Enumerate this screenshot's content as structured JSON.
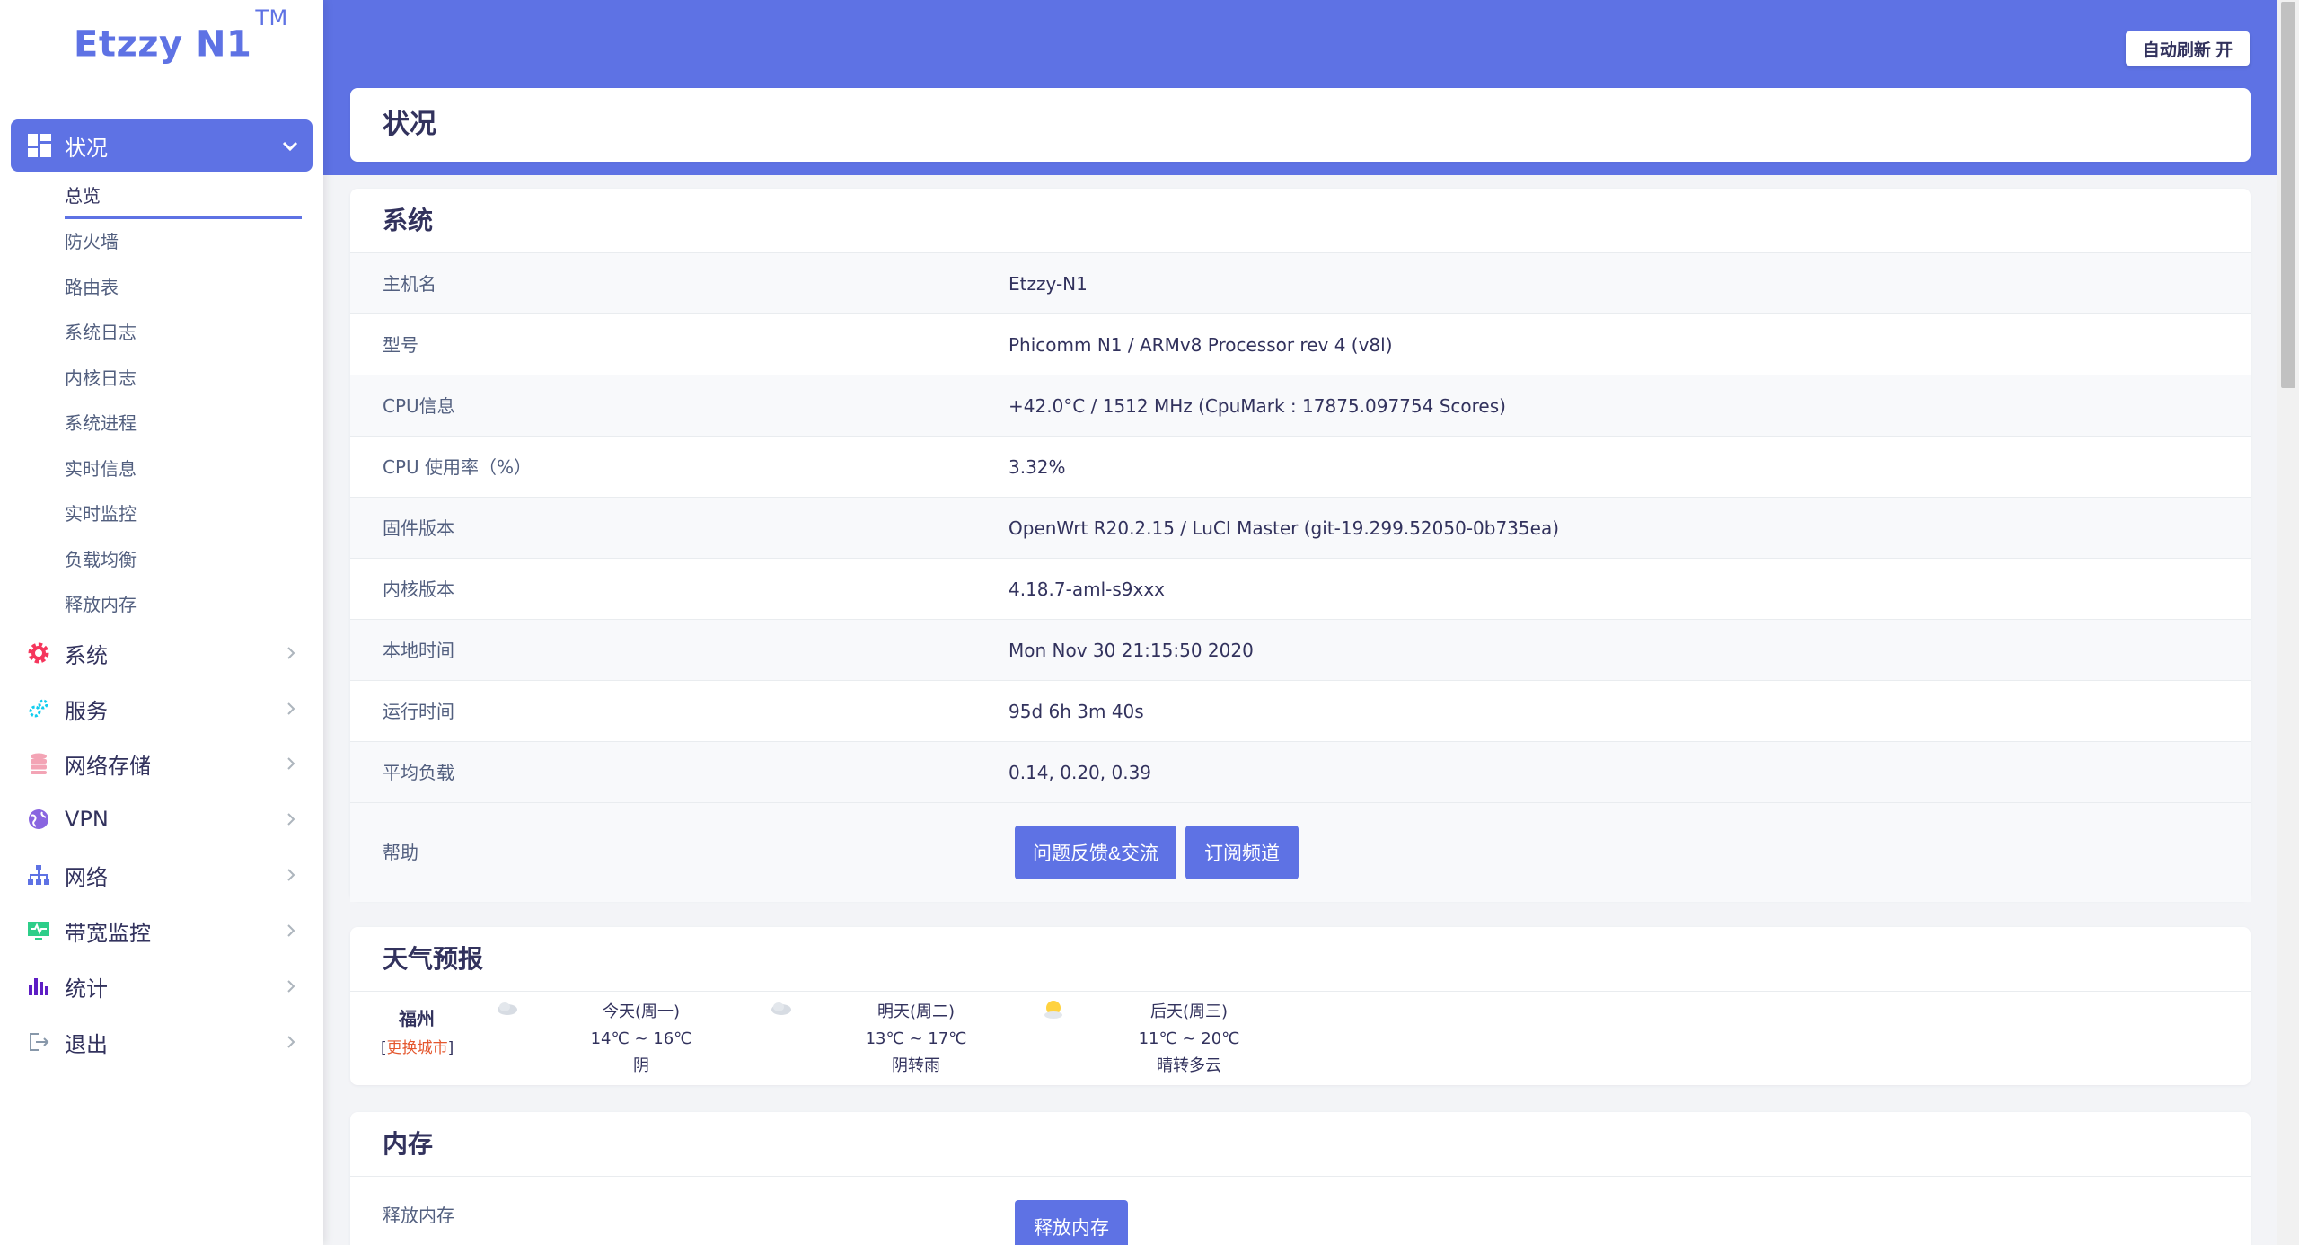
{
  "brand": {
    "name": "Etzzy N1",
    "tm": "TM"
  },
  "sidebar": {
    "active": {
      "label": "状况",
      "icon": "dashboard-icon"
    },
    "submenu": [
      "总览",
      "防火墙",
      "路由表",
      "系统日志",
      "内核日志",
      "系统进程",
      "实时信息",
      "实时监控",
      "负载均衡",
      "释放内存"
    ],
    "items": [
      {
        "label": "系统",
        "icon": "gear-icon",
        "color": "#f5365c"
      },
      {
        "label": "服务",
        "icon": "gears-icon",
        "color": "#11cdef"
      },
      {
        "label": "网络存储",
        "icon": "database-icon",
        "color": "#f3a4b5"
      },
      {
        "label": "VPN",
        "icon": "globe-icon",
        "color": "#8965e0"
      },
      {
        "label": "网络",
        "icon": "network-icon",
        "color": "#5e72e4"
      },
      {
        "label": "带宽监控",
        "icon": "monitor-icon",
        "color": "#2dce89"
      },
      {
        "label": "统计",
        "icon": "bar-chart-icon",
        "color": "#5e1ec4"
      },
      {
        "label": "退出",
        "icon": "logout-icon",
        "color": "#8898aa"
      }
    ]
  },
  "header": {
    "refresh_label": "自动刷新 开"
  },
  "page_title": "状况",
  "system": {
    "title": "系统",
    "rows": [
      {
        "key": "主机名",
        "value": "Etzzy-N1"
      },
      {
        "key": "型号",
        "value": "Phicomm N1 / ARMv8 Processor rev 4 (v8l)"
      },
      {
        "key": "CPU信息",
        "value": "+42.0°C / 1512 MHz (CpuMark : 17875.097754 Scores)"
      },
      {
        "key": "CPU 使用率（%）",
        "value": "3.32%"
      },
      {
        "key": "固件版本",
        "value": "OpenWrt R20.2.15 / LuCI Master (git-19.299.52050-0b735ea)"
      },
      {
        "key": "内核版本",
        "value": "4.18.7-aml-s9xxx"
      },
      {
        "key": "本地时间",
        "value": "Mon Nov 30 21:15:50 2020"
      },
      {
        "key": "运行时间",
        "value": "95d 6h 3m 40s"
      },
      {
        "key": "平均负载",
        "value": "0.14, 0.20, 0.39"
      }
    ],
    "help_label": "帮助",
    "feedback_button": "问题反馈&交流",
    "subscribe_button": "订阅频道"
  },
  "weather": {
    "title": "天气预报",
    "city": "福州",
    "change_city_link": "更换城市",
    "days": [
      {
        "label": "今天(周一)",
        "temp": "14℃ ~ 16℃",
        "desc": "阴",
        "icon": "cloud-icon"
      },
      {
        "label": "明天(周二)",
        "temp": "13℃ ~ 17℃",
        "desc": "阴转雨",
        "icon": "cloud-icon"
      },
      {
        "label": "后天(周三)",
        "temp": "11℃ ~ 20℃",
        "desc": "晴转多云",
        "icon": "sun-icon"
      }
    ]
  },
  "memory": {
    "title": "内存",
    "release_label": "释放内存",
    "release_button": "释放内存"
  }
}
